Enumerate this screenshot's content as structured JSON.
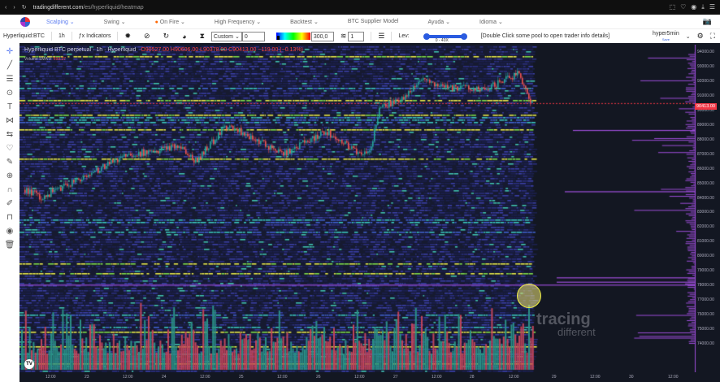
{
  "browser": {
    "url_host": "tradingdifferent.com",
    "url_path": "/es/hyperliquid/heatmap"
  },
  "nav": {
    "items": [
      "Scalping",
      "Swing",
      "On Fire",
      "High Frequency",
      "Backtest",
      "BTC Supplier Model",
      "Ayuda",
      "Idioma"
    ]
  },
  "toolbar": {
    "symbol": "Hyperliquid:BTC",
    "interval": "1h",
    "indicators": "Indicators",
    "preset": "Custom",
    "min_value": "0",
    "max_value": "300,0",
    "layers": "1",
    "lev_label": "Lev:",
    "lev_range": "0 - 40X",
    "hint": "[Double Click some pool to open trader info details]",
    "account": "hyper5min",
    "account_sub": "Save"
  },
  "legend": {
    "title": "Hyperliquid BTC perpetual · 1h · Hyperliquid",
    "ohlc": "O90527.00 H90606.00 L90378.00 C90413.00 −119.00 (−0.13%)",
    "volume_label": "Volume SMA 9",
    "volume_value": "693.27"
  },
  "price_axis": {
    "labels": [
      "94000.00",
      "93000.00",
      "92000.00",
      "91000.00",
      "90000.00",
      "89000.00",
      "88000.00",
      "87000.00",
      "86000.00",
      "85000.00",
      "84000.00",
      "83000.00",
      "82000.00",
      "81000.00",
      "80000.00",
      "79000.00",
      "78000.00",
      "77000.00",
      "76000.00",
      "75000.00",
      "74000.00"
    ],
    "current": "90413.00"
  },
  "time_axis": {
    "labels": [
      "12:00",
      "23",
      "12:00",
      "24",
      "12:00",
      "25",
      "12:00",
      "26",
      "12:00",
      "27",
      "12:00",
      "28",
      "12:00",
      "29",
      "12:00",
      "30",
      "12:00"
    ]
  },
  "watermark": {
    "line1": "tracing",
    "line2": "different"
  },
  "colors": {
    "up": "#26a69a",
    "down": "#ef5350",
    "accent": "#5b7cf0",
    "current_price": "#f23645",
    "profile": "#9c4dd8"
  }
}
